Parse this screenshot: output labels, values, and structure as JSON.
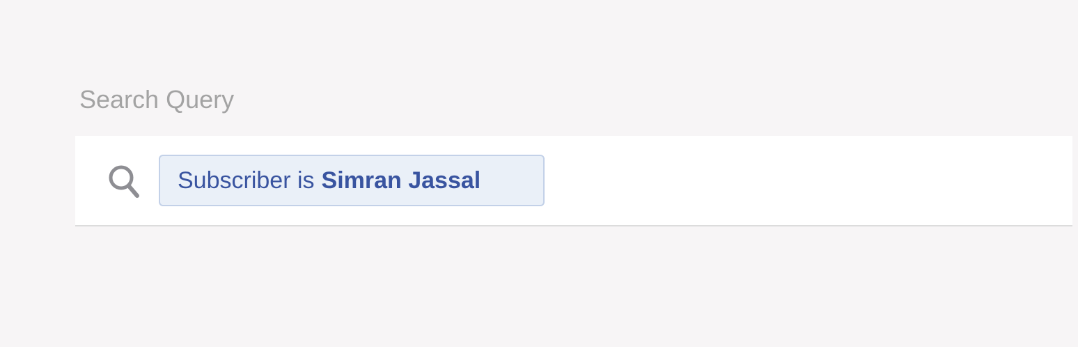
{
  "search_query": {
    "label": "Search Query",
    "icon": "search-icon",
    "token": {
      "field_text": "Subscriber is",
      "value_text": "Simran Jassal"
    }
  },
  "colors": {
    "background": "#f7f5f6",
    "panel": "#ffffff",
    "label_text": "#a3a3a3",
    "icon": "#8e8e93",
    "token_text": "#3954a0",
    "token_background": "#eaf0f8",
    "token_border": "#c3d1e8"
  }
}
